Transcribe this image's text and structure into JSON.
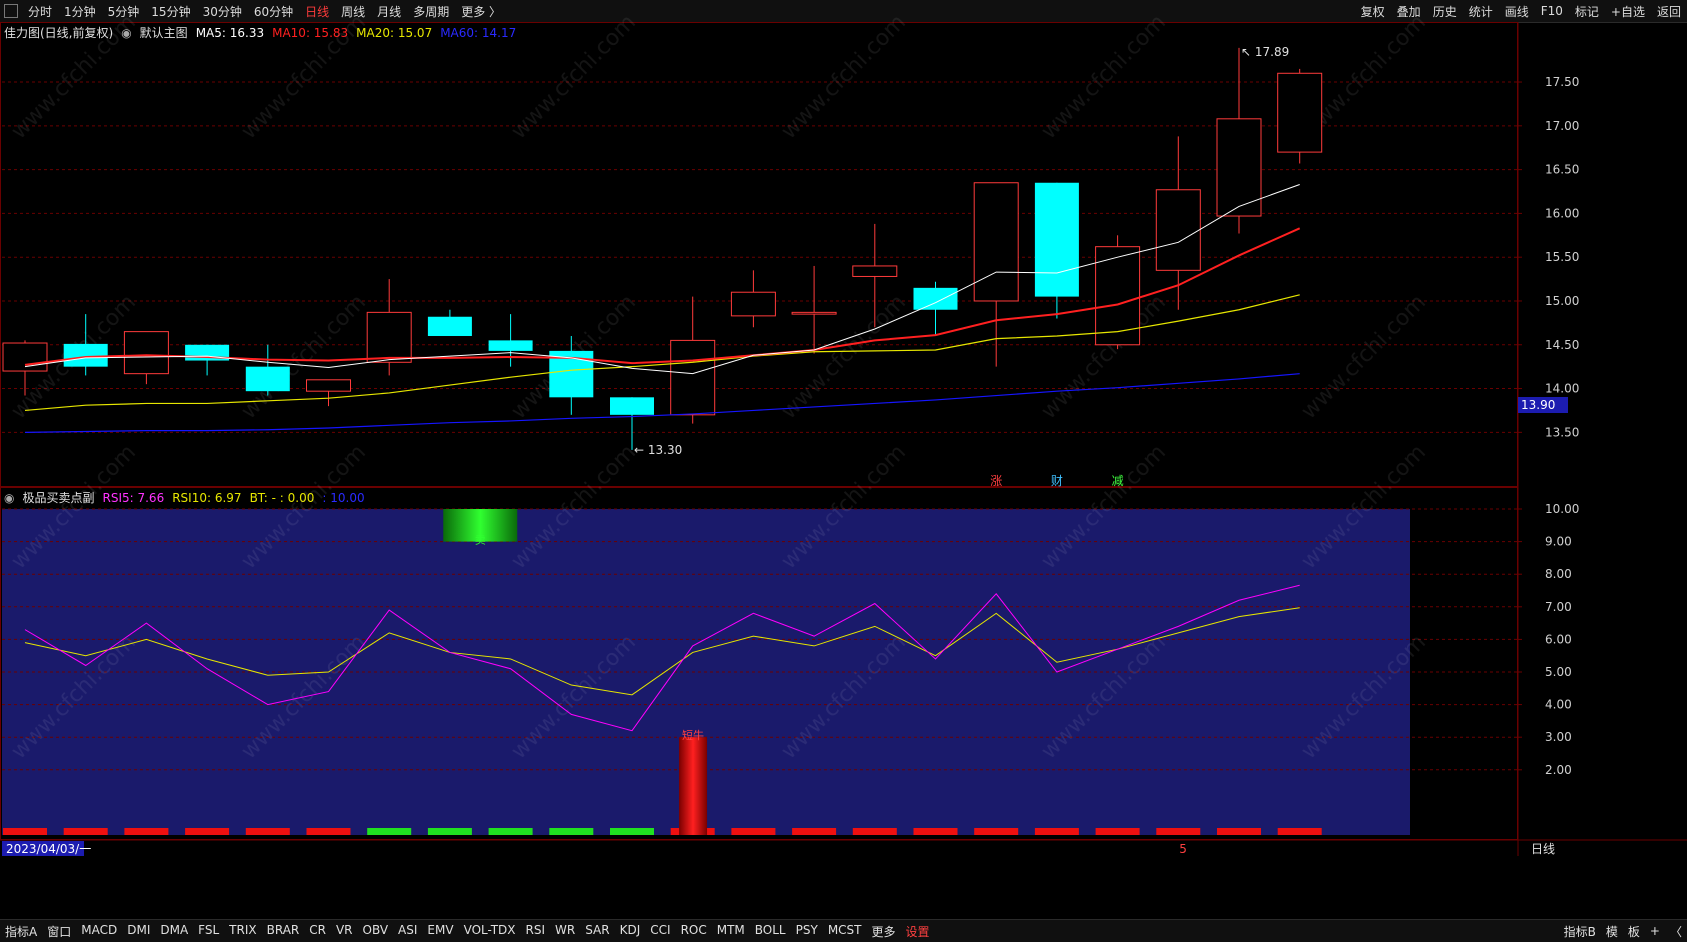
{
  "toolbar": {
    "periods": [
      "分时",
      "1分钟",
      "5分钟",
      "15分钟",
      "30分钟",
      "60分钟",
      "日线",
      "周线",
      "月线",
      "多周期",
      "更多 〉"
    ],
    "active_period": "日线",
    "right_items": [
      "复权",
      "叠加",
      "历史",
      "统计",
      "画线",
      "F10",
      "标记",
      "+自选",
      "返回"
    ]
  },
  "main_legend": {
    "stock": "佳力图(日线,前复权)",
    "indicator": "默认主图",
    "ma5": "MA5: 16.33",
    "ma10": "MA10: 15.83",
    "ma20": "MA20: 15.07",
    "ma60": "MA60: 14.17"
  },
  "sub_legend": {
    "indicator": "极品买卖点副",
    "rsi5": "RSI5: 7.66",
    "rsi10": "RSI10: 6.97",
    "bt": "BT: - : 0.00",
    "val": ": 10.00"
  },
  "colors": {
    "up": "#ff3b3b",
    "down": "#00ffff",
    "ma5": "#ffffff",
    "ma10": "#ff2020",
    "ma20": "#e6e600",
    "ma60": "#1515ff",
    "rsi5": "#ff00ff",
    "rsi10": "#e6e600",
    "subbg": "#1a1a6b",
    "grid": "#6a0000"
  },
  "chart_data": {
    "type": "candlestick",
    "candles": [
      {
        "o": 14.2,
        "c": 14.52,
        "h": 14.55,
        "l": 13.92
      },
      {
        "o": 14.51,
        "c": 14.25,
        "h": 14.85,
        "l": 14.15
      },
      {
        "o": 14.17,
        "c": 14.65,
        "h": 14.65,
        "l": 14.05
      },
      {
        "o": 14.5,
        "c": 14.32,
        "h": 14.5,
        "l": 14.15
      },
      {
        "o": 14.25,
        "c": 13.97,
        "h": 14.5,
        "l": 13.92
      },
      {
        "o": 13.97,
        "c": 14.1,
        "h": 14.1,
        "l": 13.8
      },
      {
        "o": 14.3,
        "c": 14.87,
        "h": 15.25,
        "l": 14.15
      },
      {
        "o": 14.82,
        "c": 14.6,
        "h": 14.9,
        "l": 14.6
      },
      {
        "o": 14.55,
        "c": 14.43,
        "h": 14.85,
        "l": 14.25
      },
      {
        "o": 14.43,
        "c": 13.9,
        "h": 14.6,
        "l": 13.7
      },
      {
        "o": 13.9,
        "c": 13.7,
        "h": 13.9,
        "l": 13.3
      },
      {
        "o": 13.7,
        "c": 14.55,
        "h": 15.05,
        "l": 13.6
      },
      {
        "o": 14.83,
        "c": 15.1,
        "h": 15.35,
        "l": 14.7
      },
      {
        "o": 14.85,
        "c": 14.87,
        "h": 15.4,
        "l": 14.4
      },
      {
        "o": 15.28,
        "c": 15.4,
        "h": 15.88,
        "l": 14.7
      },
      {
        "o": 15.15,
        "c": 14.9,
        "h": 15.22,
        "l": 14.6
      },
      {
        "o": 15.0,
        "c": 16.35,
        "h": 16.35,
        "l": 14.25
      },
      {
        "o": 16.35,
        "c": 15.05,
        "h": 16.35,
        "l": 14.8
      },
      {
        "o": 14.5,
        "c": 15.62,
        "h": 15.75,
        "l": 14.45
      },
      {
        "o": 15.35,
        "c": 16.27,
        "h": 16.88,
        "l": 14.9
      },
      {
        "o": 15.97,
        "c": 17.08,
        "h": 17.89,
        "l": 15.77
      },
      {
        "o": 16.7,
        "c": 17.6,
        "h": 17.65,
        "l": 16.57
      }
    ],
    "ma5": [
      14.25,
      14.35,
      14.36,
      14.37,
      14.3,
      14.24,
      14.33,
      14.37,
      14.41,
      14.35,
      14.23,
      14.17,
      14.38,
      14.44,
      14.68,
      14.98,
      15.33,
      15.32,
      15.5,
      15.67,
      16.08,
      16.33
    ],
    "ma10": [
      14.27,
      14.36,
      14.38,
      14.36,
      14.33,
      14.32,
      14.35,
      14.35,
      14.36,
      14.35,
      14.29,
      14.32,
      14.38,
      14.44,
      14.55,
      14.61,
      14.78,
      14.85,
      14.96,
      15.18,
      15.52,
      15.83
    ],
    "ma20": [
      13.75,
      13.81,
      13.83,
      13.83,
      13.86,
      13.89,
      13.95,
      14.04,
      14.13,
      14.21,
      14.25,
      14.3,
      14.37,
      14.42,
      14.43,
      14.44,
      14.57,
      14.6,
      14.65,
      14.77,
      14.9,
      15.07
    ],
    "ma60": [
      13.5,
      13.51,
      13.52,
      13.52,
      13.53,
      13.55,
      13.58,
      13.61,
      13.63,
      13.66,
      13.68,
      13.71,
      13.75,
      13.79,
      13.83,
      13.87,
      13.92,
      13.97,
      14.01,
      14.06,
      14.11,
      14.17
    ],
    "price_axis": [
      "17.50",
      "17.00",
      "16.50",
      "16.00",
      "15.50",
      "15.00",
      "14.50",
      "14.00",
      "13.50"
    ],
    "price_range": [
      13.07,
      17.98
    ],
    "high_label": "17.89",
    "low_label": "13.30",
    "current_price": "13.90",
    "markers": [
      {
        "index": 16,
        "text": "涨",
        "color": "#ff4040"
      },
      {
        "index": 17,
        "text": "财",
        "color": "#40c0ff"
      },
      {
        "index": 18,
        "text": "减",
        "color": "#40ff40"
      }
    ],
    "sub_axis": [
      "10.00",
      "9.00",
      "8.00",
      "7.00",
      "6.00",
      "5.00",
      "4.00",
      "3.00",
      "2.00"
    ],
    "sub_range": [
      0,
      10
    ],
    "rsi5": [
      6.3,
      5.2,
      6.5,
      5.1,
      4.0,
      4.4,
      6.9,
      5.6,
      5.1,
      3.7,
      3.2,
      5.8,
      6.8,
      6.1,
      7.1,
      5.4,
      7.4,
      5.0,
      5.7,
      6.4,
      7.2,
      7.66
    ],
    "rsi10": [
      5.9,
      5.5,
      6.0,
      5.4,
      4.9,
      5.0,
      6.2,
      5.6,
      5.4,
      4.6,
      4.3,
      5.6,
      6.1,
      5.8,
      6.4,
      5.5,
      6.8,
      5.3,
      5.7,
      6.2,
      6.7,
      6.97
    ],
    "base_bar_colors": [
      "r",
      "r",
      "r",
      "r",
      "r",
      "r",
      "g",
      "g",
      "g",
      "g",
      "g",
      "r",
      "r",
      "r",
      "r",
      "r",
      "r",
      "r",
      "r",
      "r",
      "r",
      "r"
    ],
    "sell_signal_label": "卖",
    "buy_signal_label": "短牛",
    "bottom_ma_label": "5",
    "date_label": "2023/04/03/一",
    "period_label": "日线"
  },
  "bottom_tabs": [
    "指标A",
    "窗口",
    "MACD",
    "DMI",
    "DMA",
    "FSL",
    "TRIX",
    "BRAR",
    "CR",
    "VR",
    "OBV",
    "ASI",
    "EMV",
    "VOL-TDX",
    "RSI",
    "WR",
    "SAR",
    "KDJ",
    "CCI",
    "ROC",
    "MTM",
    "BOLL",
    "PSY",
    "MCST",
    "更多",
    "设置"
  ],
  "bottom_right": [
    "指标B",
    "模",
    "板",
    "+",
    "〈"
  ],
  "watermark": "www.cfchi.com"
}
